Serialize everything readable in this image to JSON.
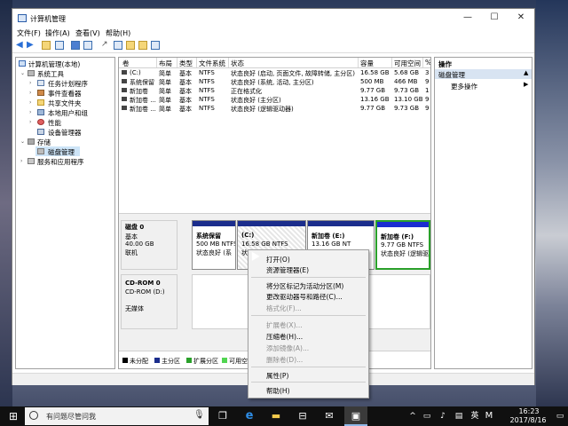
{
  "window": {
    "title": "计算机管理"
  },
  "menu": [
    "文件(F)",
    "操作(A)",
    "查看(V)",
    "帮助(H)"
  ],
  "tree": [
    {
      "label": "计算机管理(本地)",
      "level": 0
    },
    {
      "label": "系统工具",
      "level": 1
    },
    {
      "label": "任务计划程序",
      "level": 2
    },
    {
      "label": "事件查看器",
      "level": 2
    },
    {
      "label": "共享文件夹",
      "level": 2
    },
    {
      "label": "本地用户和组",
      "level": 2
    },
    {
      "label": "性能",
      "level": 2
    },
    {
      "label": "设备管理器",
      "level": 2
    },
    {
      "label": "存储",
      "level": 1
    },
    {
      "label": "磁盘管理",
      "level": 2
    },
    {
      "label": "服务和应用程序",
      "level": 1
    }
  ],
  "volume_table": {
    "headers": [
      "卷",
      "布局",
      "类型",
      "文件系统",
      "状态",
      "容量",
      "可用空间",
      "%"
    ],
    "rows": [
      [
        "(C:)",
        "简单",
        "基本",
        "NTFS",
        "状态良好 (启动, 页面文件, 故障转储, 主分区)",
        "16.58 GB",
        "5.68 GB",
        "3"
      ],
      [
        "系统保留",
        "简单",
        "基本",
        "NTFS",
        "状态良好 (系统, 活动, 主分区)",
        "500 MB",
        "466 MB",
        "9"
      ],
      [
        "新加卷",
        "简单",
        "基本",
        "NTFS",
        "正在格式化",
        "9.77 GB",
        "9.73 GB",
        "1"
      ],
      [
        "新加卷 ...",
        "简单",
        "基本",
        "NTFS",
        "状态良好 (主分区)",
        "13.16 GB",
        "13.10 GB",
        "9"
      ],
      [
        "新加卷 ...",
        "简单",
        "基本",
        "NTFS",
        "状态良好 (逻辑驱动器)",
        "9.77 GB",
        "9.73 GB",
        "9"
      ]
    ]
  },
  "disks": [
    {
      "name": "磁盘 0",
      "type": "基本",
      "size": "40.00 GB",
      "status": "联机"
    },
    {
      "name": "CD-ROM 0",
      "type": "CD-ROM (D:)",
      "size": "",
      "status": "无媒体"
    }
  ],
  "partitions": [
    {
      "name": "系统保留",
      "size": "500 MB NTFS",
      "status": "状态良好 (系"
    },
    {
      "name": "(C:)",
      "size": "16.58 GB NTFS",
      "status": "状态良"
    },
    {
      "name": "新加卷 (E:)",
      "size": "13.16 GB NT",
      "status": ""
    },
    {
      "name": "新加卷 (F:)",
      "size": "9.77 GB NTFS",
      "status": "状态良好 (逻辑驱动"
    }
  ],
  "legend": [
    "未分配",
    "主分区",
    "扩展分区",
    "可用空"
  ],
  "actions": {
    "header": "操作",
    "section": "磁盘管理",
    "item": "更多操作"
  },
  "context_menu": [
    {
      "label": "打开(O)",
      "enabled": true
    },
    {
      "label": "资源管理器(E)",
      "enabled": true
    },
    {
      "label": "将分区标记为活动分区(M)",
      "enabled": true
    },
    {
      "label": "更改驱动器号和路径(C)...",
      "enabled": true
    },
    {
      "label": "格式化(F)...",
      "enabled": false
    },
    {
      "label": "扩展卷(X)...",
      "enabled": false
    },
    {
      "label": "压缩卷(H)...",
      "enabled": true
    },
    {
      "label": "添加镜像(A)...",
      "enabled": false
    },
    {
      "label": "删除卷(D)...",
      "enabled": false
    },
    {
      "label": "属性(P)",
      "enabled": true
    },
    {
      "label": "帮助(H)",
      "enabled": true
    }
  ],
  "taskbar": {
    "search_placeholder": "有问题尽管问我",
    "ime": "英",
    "time": "16:23",
    "date": "2017/8/16"
  },
  "colors": {
    "primary": "#1b2d8c",
    "extended": "#2aa02a",
    "free": "#51d551",
    "unallocated": "#000000",
    "selection": "#cde4f7"
  }
}
